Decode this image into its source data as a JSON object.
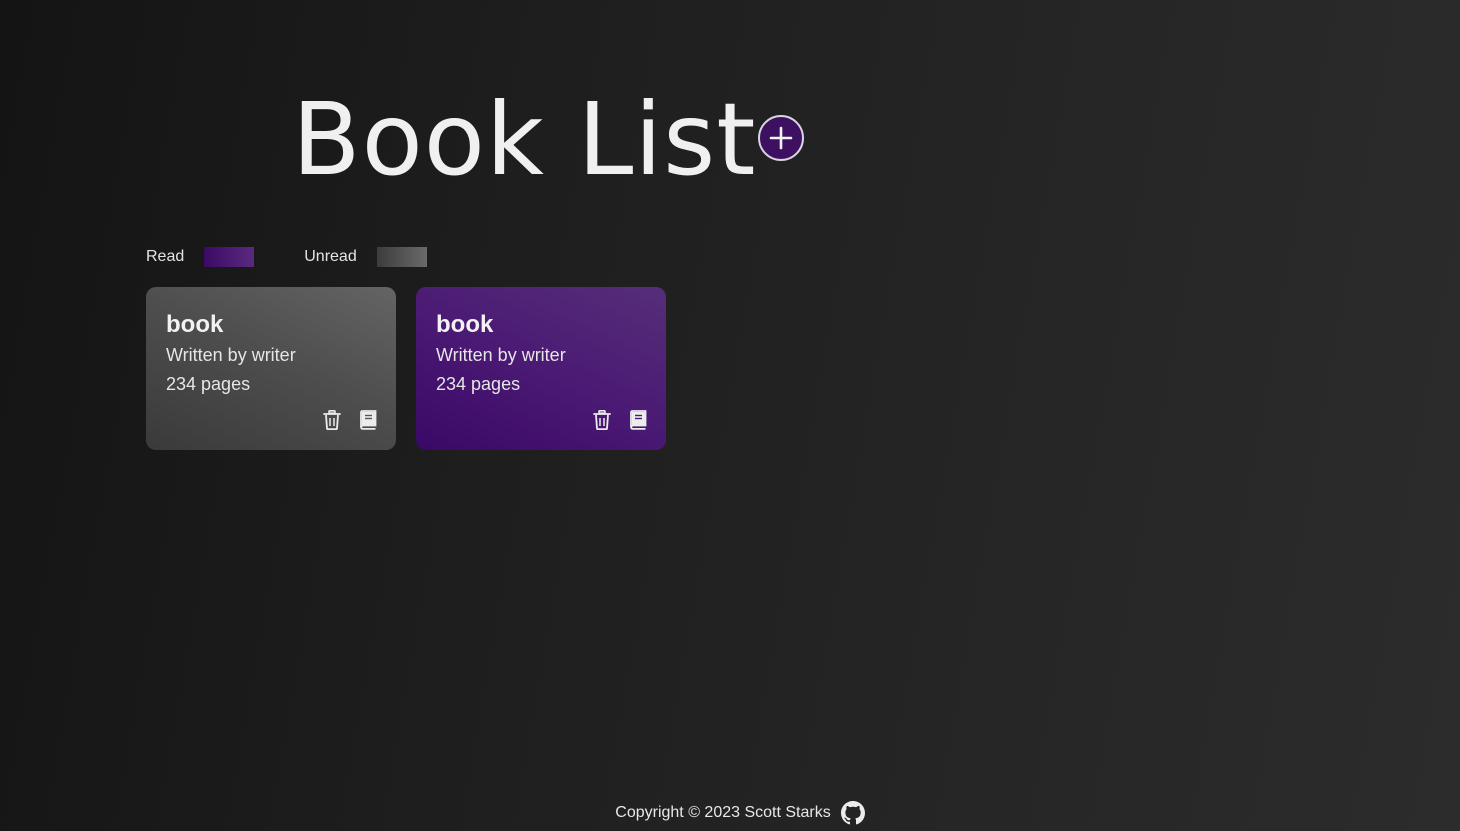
{
  "header": {
    "title": "Book List",
    "add_button_icon": "plus-icon"
  },
  "legend": {
    "read_label": "Read",
    "unread_label": "Unread",
    "read_color": "#3b0a64",
    "unread_color": "#4a4a4a"
  },
  "books": [
    {
      "title": "book",
      "author_line": "Written by writer",
      "pages_line": "234 pages",
      "status": "unread",
      "icons": [
        "trash-icon",
        "book-icon"
      ]
    },
    {
      "title": "book",
      "author_line": "Written by writer",
      "pages_line": "234 pages",
      "status": "read",
      "icons": [
        "trash-icon",
        "book-icon"
      ]
    }
  ],
  "footer": {
    "copyright": "Copyright © 2023 Scott Starks",
    "link_icon": "github-icon"
  },
  "colors": {
    "accent": "#3e1062",
    "text": "#ececec"
  }
}
